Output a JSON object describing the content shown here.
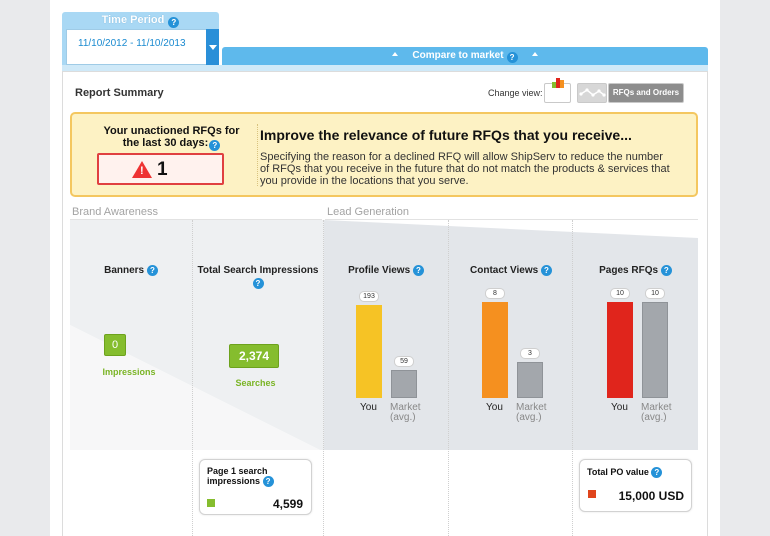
{
  "time_period": {
    "title": "Time Period",
    "value": "11/10/2012 - 11/10/2013"
  },
  "compare": {
    "label": "Compare to market"
  },
  "report": {
    "title": "Report Summary",
    "change_view_label": "Change view:",
    "rfqs_orders_label": "RFQs and Orders"
  },
  "notice": {
    "left_title": "Your unactioned RFQs for the last 30 days:",
    "count": "1",
    "headline": "Improve the relevance of future RFQs that you receive...",
    "body": "Specifying the reason for a declined RFQ will allow ShipServ to reduce the number of RFQs that you receive in the future that do not match the products & services that you provide in the locations that you serve."
  },
  "sections": {
    "brand": "Brand Awareness",
    "lead": "Lead Generation"
  },
  "banners": {
    "title": "Banners",
    "value": "0",
    "unit": "Impressions"
  },
  "impressions": {
    "title": "Total Search Impressions",
    "value": "2,374",
    "unit": "Searches",
    "page1_title": "Page 1 search impressions",
    "page1_value": "4,599"
  },
  "profile_views": {
    "title": "Profile Views",
    "you": 193,
    "market": 59,
    "max": 200,
    "you_label": "You",
    "market_label": "Market (avg.)"
  },
  "contact_views": {
    "title": "Contact Views",
    "you": 8,
    "market": 3,
    "max": 8,
    "you_label": "You",
    "market_label": "Market (avg.)"
  },
  "pages_rfqs": {
    "title": "Pages RFQs",
    "you": 10,
    "market": 10,
    "max": 10,
    "you_label": "You",
    "market_label": "Market (avg.)"
  },
  "po": {
    "title": "Total PO value",
    "value": "15,000 USD"
  },
  "colors": {
    "yellow": "#f6c325",
    "orange": "#f5901f",
    "red": "#e0251c",
    "gray": "#a3a7ac",
    "green": "#7ab425",
    "blue": "#2592d8"
  },
  "icons": [
    "help-icon",
    "dropdown-arrow-icon",
    "collapse-arrow-icon",
    "warning-icon",
    "bar-chart-icon",
    "line-chart-icon"
  ]
}
